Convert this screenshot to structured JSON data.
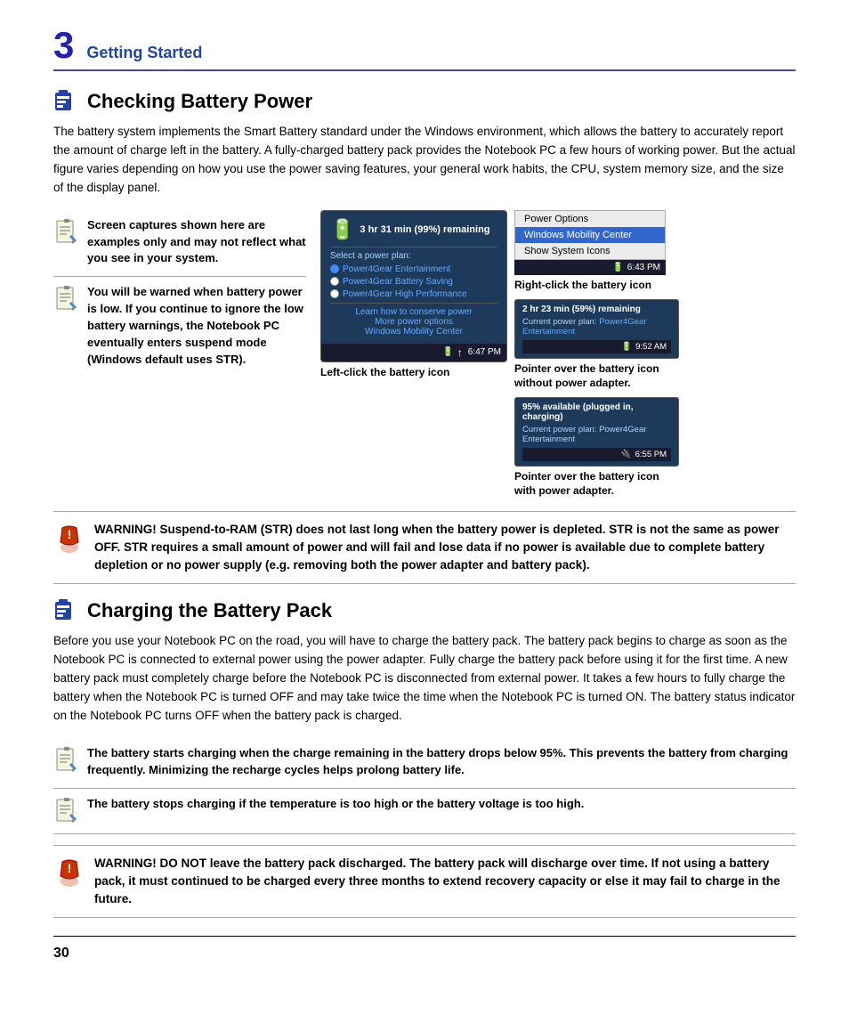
{
  "chapter": {
    "number": "3",
    "title": "Getting Started"
  },
  "sections": {
    "checking_battery": {
      "title": "Checking Battery Power",
      "body": "The battery system implements the Smart Battery standard under the Windows environment, which allows the battery to accurately report the amount of charge left in the battery. A fully-charged battery pack provides the Notebook PC a few hours of working power. But the actual figure varies depending on how you use the power saving features, your general work habits, the CPU, system memory size, and the size of the display panel."
    },
    "charging_battery": {
      "title": "Charging the Battery Pack",
      "body": "Before you use your Notebook PC on the road, you will have to charge the battery pack. The battery pack begins to charge as soon as the Notebook PC is connected to external power using the power adapter. Fully charge the battery pack before using it for the first time. A new battery pack must completely charge before the Notebook PC is disconnected from external power. It takes a few hours to fully charge the battery when the Notebook PC is turned OFF and may take twice the time when the Notebook PC is turned ON. The battery status indicator on the Notebook PC turns OFF when the battery pack is charged."
    }
  },
  "notes": {
    "note1": {
      "text": "Screen captures shown here are examples only and may not reflect what you see in your system."
    },
    "note2": {
      "text": "You will be warned when battery power is low. If you continue to ignore the low battery warnings, the Notebook PC eventually enters suspend mode (Windows default uses STR)."
    },
    "note3": {
      "text": "The battery starts charging when the charge remaining in the battery drops below 95%. This prevents the battery from charging frequently. Minimizing the recharge cycles helps prolong battery life."
    },
    "note4": {
      "text": "The battery stops charging if the temperature is too high or the battery voltage is too high."
    }
  },
  "warnings": {
    "warning1": {
      "text": "WARNING!  Suspend-to-RAM (STR) does not last long when the battery power is depleted. STR is not the same as power OFF. STR requires a small amount of power and will fail and lose data if no power is available due to complete battery depletion or no power supply (e.g. removing both the power adapter and battery pack)."
    },
    "warning2": {
      "text": "WARNING!  DO NOT leave the battery pack discharged. The battery pack will discharge over time. If not using a battery pack, it must continued to be charged every three months to extend recovery capacity or else it may fail to charge in the future."
    }
  },
  "screenshots": {
    "left_popup": {
      "time_text": "3 hr 31 min (99%) remaining",
      "select_label": "Select a power plan:",
      "plans": [
        "Power4Gear Entertainment",
        "Power4Gear Battery Saving",
        "Power4Gear High Performance"
      ],
      "links": [
        "Learn how to conserve power",
        "More power options",
        "Windows Mobility Center"
      ],
      "time": "6:47 PM",
      "caption": "Left-click the battery icon"
    },
    "right_click_menu": {
      "items": [
        "Power Options",
        "Windows Mobility Center",
        "Show System Icons"
      ],
      "time": "6:43 PM",
      "caption": "Right-click the battery icon"
    },
    "hover_no_adapter": {
      "batt_time": "2 hr 23 min (59%) remaining",
      "plan_label": "Current power plan:",
      "plan_name": "Power4Gear Entertainment",
      "time": "9:52 AM",
      "caption": "Pointer over the battery icon\nwithout power adapter."
    },
    "hover_with_adapter": {
      "batt_time": "95% available (plugged in, charging)",
      "plan_label": "Current power plan:  Power4Gear Entertainment",
      "time": "6:55 PM",
      "caption": "Pointer over the battery icon\nwith power adapter."
    }
  },
  "page_number": "30"
}
